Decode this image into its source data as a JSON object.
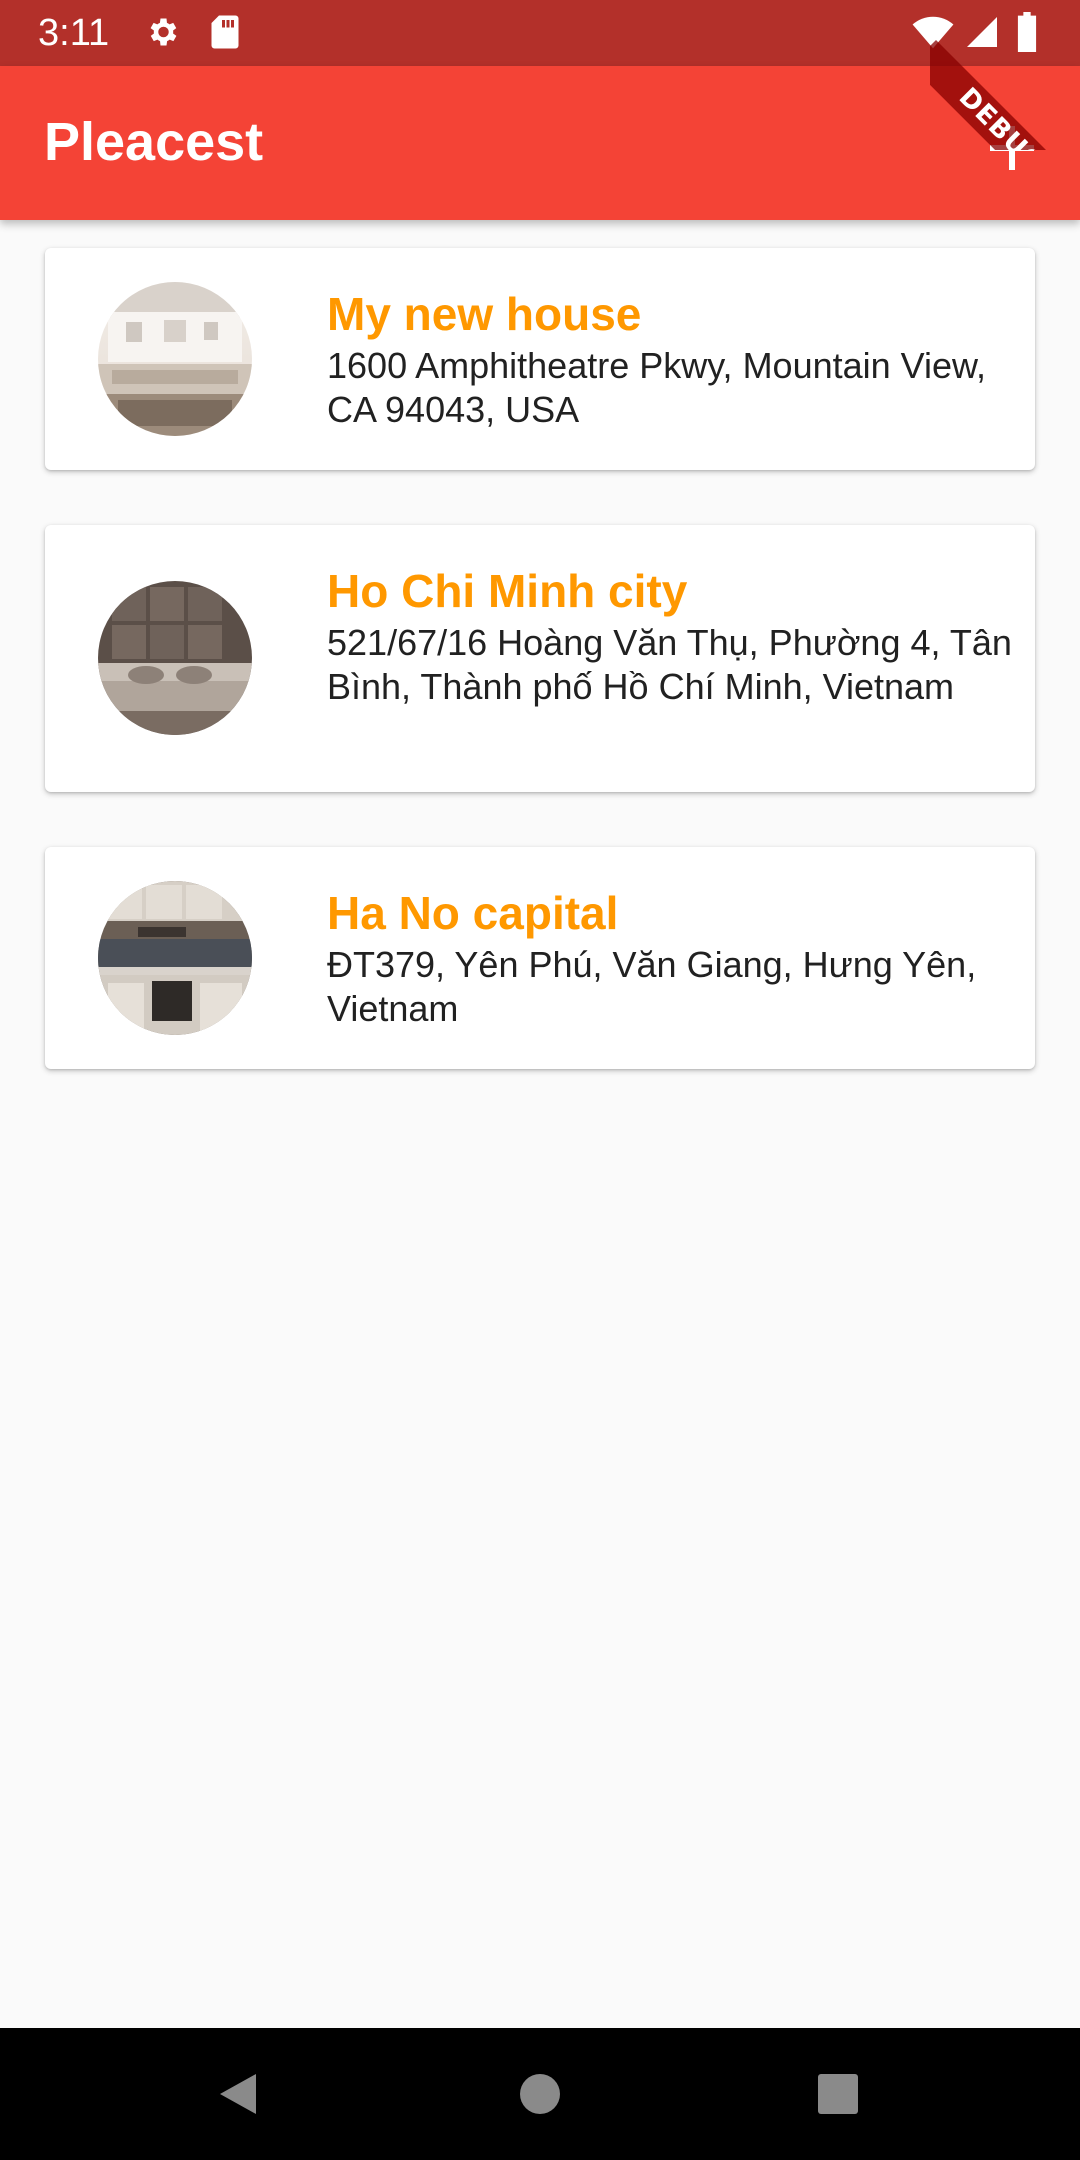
{
  "status_bar": {
    "time": "3:11",
    "icons": [
      "gear-icon",
      "sd-card-icon",
      "wifi-icon",
      "signal-icon",
      "battery-icon"
    ]
  },
  "app_bar": {
    "title": "Pleacest",
    "add_icon": "plus-icon",
    "debug_label": "DEBUG",
    "color": "#f44336"
  },
  "places": [
    {
      "title": "My new house",
      "address": "1600 Amphitheatre Pkwy, Mountain View, CA 94043, USA",
      "thumbnail": "living-room-photo"
    },
    {
      "title": "Ho Chi Minh city",
      "address": "521/67/16 Hoàng Văn Thụ, Phường 4, Tân Bình, Thành phố Hồ Chí Minh, Vietnam",
      "thumbnail": "bedroom-photo"
    },
    {
      "title": "Ha No capital",
      "address": "ĐT379, Yên Phú, Văn Giang, Hưng Yên, Vietnam",
      "thumbnail": "kitchen-photo"
    }
  ],
  "colors": {
    "accent": "#ff9800",
    "status_bar": "#b3302a",
    "background": "#fafafa"
  },
  "nav_bar": {
    "icons": [
      "back-icon",
      "home-icon",
      "recents-icon"
    ]
  }
}
